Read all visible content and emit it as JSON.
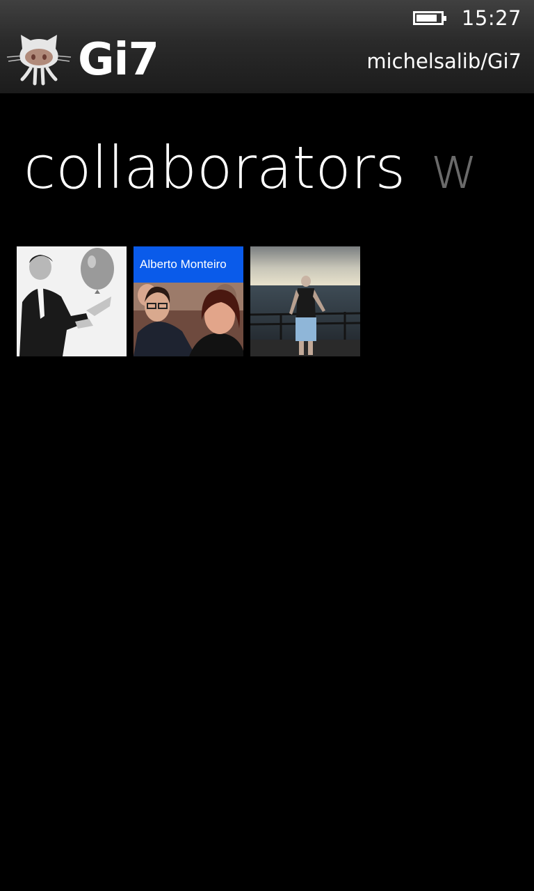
{
  "status_bar": {
    "time": "15:27",
    "battery_level": 0.85
  },
  "header": {
    "app_title": "Gi7",
    "logo_icon": "octocat-icon",
    "repo_name": "michelsalib/Gi7"
  },
  "pivot": {
    "active_label": "collaborators",
    "next_label": "w"
  },
  "collaborators": [
    {
      "avatar": "man-with-balloon-photo"
    },
    {
      "name": "Alberto Monteiro",
      "avatar": "two-people-photo"
    },
    {
      "avatar": "person-by-sea-photo"
    }
  ],
  "colors": {
    "background": "#000000",
    "accent": "#0a5bea",
    "inactive_pivot": "#6a6a6a"
  }
}
